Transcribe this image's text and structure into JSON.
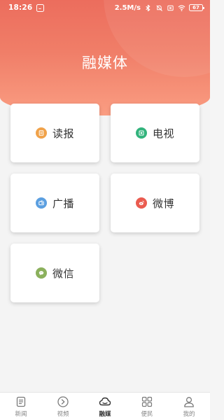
{
  "status_bar": {
    "time": "18:26",
    "speed": "2.5M/s",
    "battery": "67"
  },
  "header": {
    "title": "融媒体"
  },
  "cards": [
    {
      "id": "read-paper",
      "label": "读报",
      "icon": "newspaper-icon",
      "color": "#f0a24a"
    },
    {
      "id": "tv",
      "label": "电视",
      "icon": "tv-icon",
      "color": "#32b37c"
    },
    {
      "id": "radio",
      "label": "广播",
      "icon": "radio-icon",
      "color": "#5b9fe0"
    },
    {
      "id": "weibo",
      "label": "微博",
      "icon": "weibo-icon",
      "color": "#ea5b4f"
    },
    {
      "id": "wechat",
      "label": "微信",
      "icon": "wechat-icon",
      "color": "#8bb05c"
    }
  ],
  "bottom_nav": [
    {
      "id": "news",
      "label": "新闻",
      "icon": "document-icon",
      "active": false
    },
    {
      "id": "video",
      "label": "视频",
      "icon": "play-circle-icon",
      "active": false
    },
    {
      "id": "media",
      "label": "融媒",
      "icon": "cloud-icon",
      "active": true
    },
    {
      "id": "services",
      "label": "便民",
      "icon": "grid-icon",
      "active": false
    },
    {
      "id": "mine",
      "label": "我的",
      "icon": "person-icon",
      "active": false
    }
  ],
  "colors": {
    "header_top": "#ec6d5d",
    "header_bottom": "#fa9d82",
    "page_bg": "#f4f4f4"
  }
}
